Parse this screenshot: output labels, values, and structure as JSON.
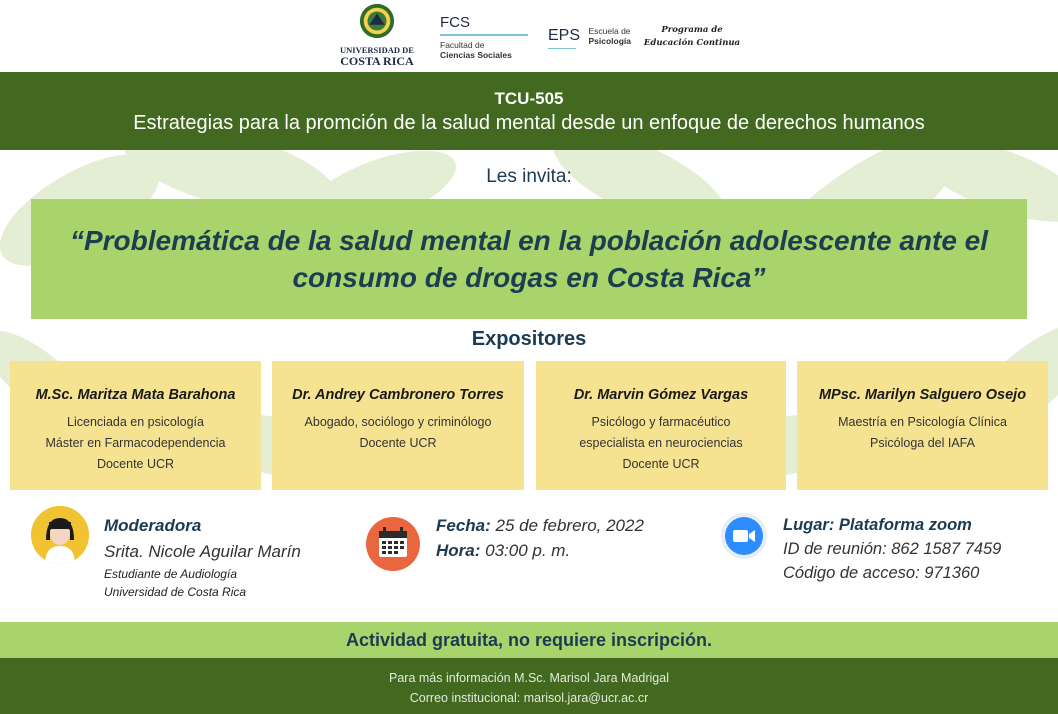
{
  "logos": {
    "ucr_line1": "UNIVERSIDAD DE",
    "ucr_line2": "COSTA RICA",
    "fcs_abbr": "FCS",
    "fcs_line1": "Facultad de",
    "fcs_line2": "Ciencias Sociales",
    "eps_abbr": "EPS",
    "eps_line1": "Escuela de",
    "eps_line2": "Psicología",
    "pec_line1": "Programa de",
    "pec_line2": "Educación Continua"
  },
  "banner": {
    "code": "TCU-505",
    "subtitle": "Estrategias para la promción de la salud mental desde un enfoque de derechos humanos"
  },
  "invite": "Les invita:",
  "event_title_line1": "“Problemática de la salud mental en la población adolescente ante el",
  "event_title_line2": "consumo de drogas en Costa Rica”",
  "speakers_heading": "Expositores",
  "speakers": [
    {
      "name": "M.Sc. Maritza Mata Barahona",
      "lines": [
        "Licenciada en psicología",
        "Máster en Farmacodependencia",
        "Docente UCR"
      ]
    },
    {
      "name": "Dr. Andrey Cambronero Torres",
      "lines": [
        "Abogado, sociólogo y criminólogo",
        "Docente UCR"
      ]
    },
    {
      "name": "Dr. Marvin Gómez Vargas",
      "lines": [
        "Psicólogo y farmacéutico",
        "especialista en neurociencias",
        "Docente UCR"
      ]
    },
    {
      "name": "MPsc. Marilyn Salguero Osejo",
      "lines": [
        "Maestría en Psicología Clínica",
        "Psicóloga del IAFA"
      ]
    }
  ],
  "moderator": {
    "label": "Moderadora",
    "name": "Srita. Nicole Aguilar Marín",
    "role1": "Estudiante de Audiología",
    "role2": "Universidad de Costa Rica"
  },
  "schedule": {
    "date_label": "Fecha:",
    "date_value": "25 de febrero, 2022",
    "time_label": "Hora:",
    "time_value": "03:00 p. m."
  },
  "location": {
    "label": "Lugar: Plataforma zoom",
    "meeting_id": "ID de reunión: 862 1587 7459",
    "access_code": "Código de acceso: 971360"
  },
  "notice": "Actividad gratuita, no requiere inscripción.",
  "footer": {
    "line1": "Para más información M.Sc. Marisol Jara Madrigal",
    "line2": "Correo institucional: marisol.jara@ucr.ac.cr"
  },
  "colors": {
    "dark_green": "#42691f",
    "light_green": "#a9d46c",
    "card_yellow": "#f6e391",
    "navy_text": "#1c3b52"
  },
  "icons": [
    "ucr-crest-icon",
    "avatar-icon",
    "calendar-icon",
    "zoom-camera-icon"
  ]
}
